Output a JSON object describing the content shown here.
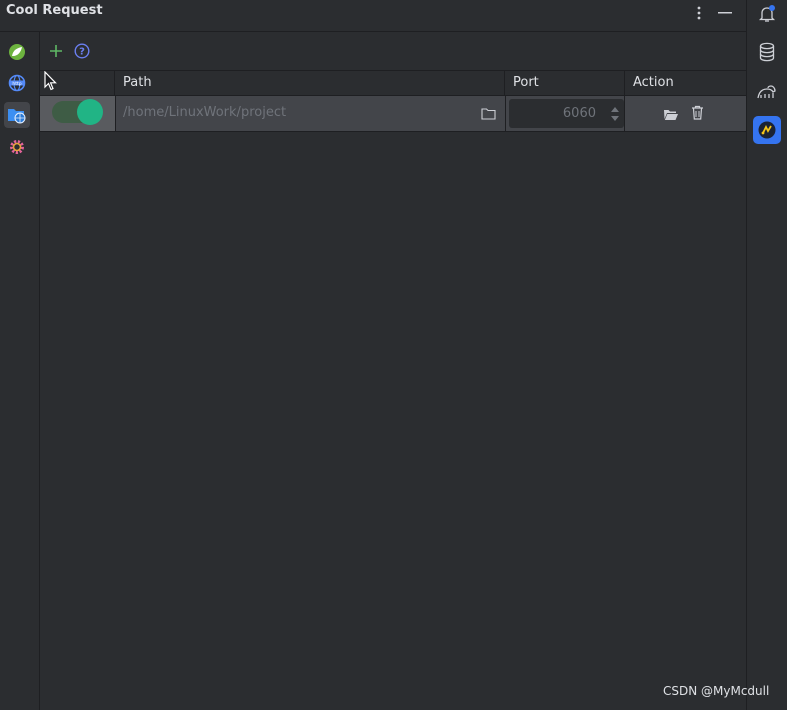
{
  "window": {
    "title": "Cool Request"
  },
  "titlebar_actions": {
    "more_icon": "more-vertical-icon",
    "minimize_icon": "minimize-icon"
  },
  "left_sidebar": {
    "items": [
      {
        "name": "spring-leaf-icon",
        "active": false
      },
      {
        "name": "http-globe-icon",
        "active": false
      },
      {
        "name": "static-server-folder-icon",
        "active": true
      },
      {
        "name": "settings-gear-icon",
        "active": false
      }
    ]
  },
  "toolbar": {
    "add_icon": "add-icon",
    "help_icon": "help-icon"
  },
  "table": {
    "columns": [
      "",
      "Path",
      "Port",
      "Action"
    ],
    "rows": [
      {
        "enabled": true,
        "path": "/home/LinuxWork/project",
        "port": "6060"
      }
    ]
  },
  "right_sidebar": {
    "items": [
      {
        "name": "notifications-bell-icon",
        "badge": true
      },
      {
        "name": "database-icon"
      },
      {
        "name": "gradle-icon"
      },
      {
        "name": "cool-request-plugin-icon",
        "active": true
      }
    ]
  },
  "watermark": "CSDN @MyMcdull",
  "colors": {
    "accent": "#3574f0",
    "toggle_on": "#21b485",
    "row_bg": "#43454a",
    "bg": "#2b2d30"
  }
}
